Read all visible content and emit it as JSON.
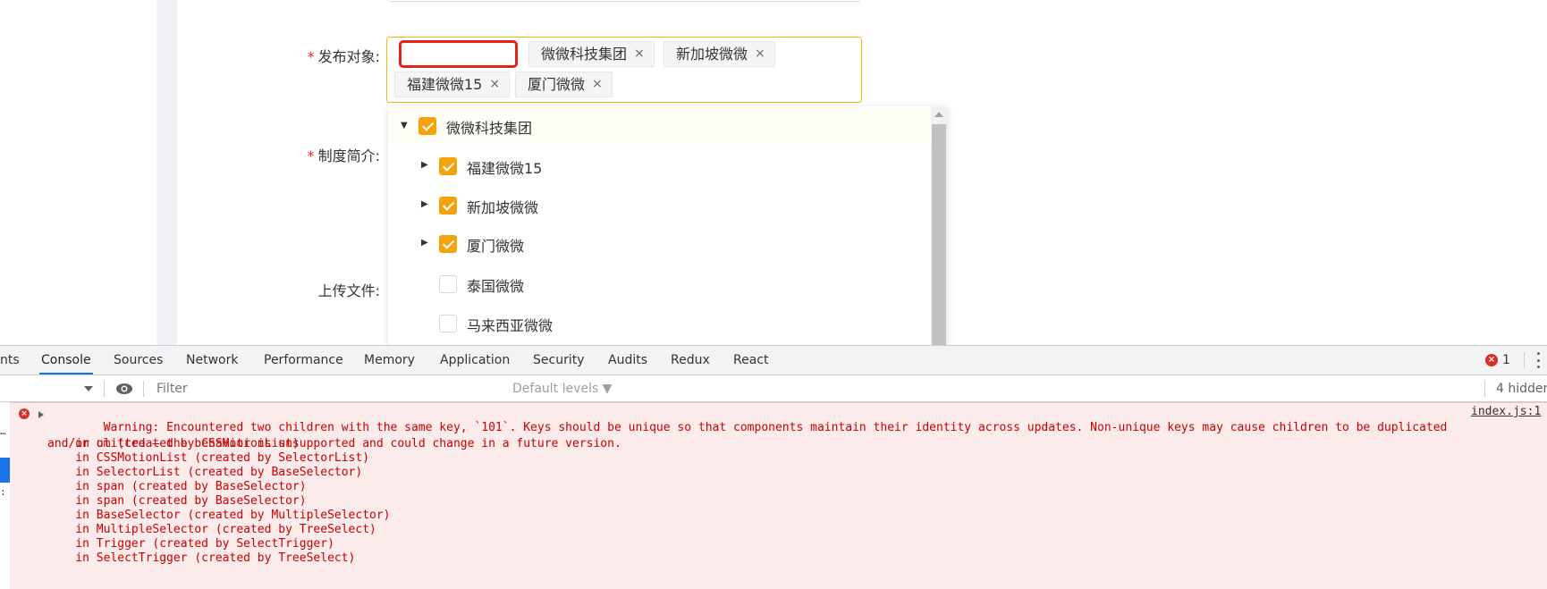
{
  "form": {
    "publish_target_label": "发布对象:",
    "policy_intro_label": "制度简介:",
    "upload_label": "上传文件:",
    "required_mark": "*",
    "search_value": "",
    "tags": [
      {
        "label": "微微科技集团"
      },
      {
        "label": "新加坡微微"
      },
      {
        "label": "福建微微15"
      },
      {
        "label": "厦门微微"
      }
    ],
    "tag_close_glyph": "×"
  },
  "tree": {
    "nodes": [
      {
        "label": "微微科技集团",
        "checked": true,
        "expanded": true,
        "level": 0
      },
      {
        "label": "福建微微15",
        "checked": true,
        "expanded": false,
        "level": 1
      },
      {
        "label": "新加坡微微",
        "checked": true,
        "expanded": false,
        "level": 1
      },
      {
        "label": "厦门微微",
        "checked": true,
        "expanded": false,
        "level": 1
      },
      {
        "label": "泰国微微",
        "checked": false,
        "expanded": false,
        "level": 1
      },
      {
        "label": "马来西亚微微",
        "checked": false,
        "expanded": false,
        "level": 1
      }
    ]
  },
  "devtools": {
    "partial_tab": "nts",
    "tabs": [
      "Console",
      "Sources",
      "Network",
      "Performance",
      "Memory",
      "Application",
      "Security",
      "Audits",
      "Redux",
      "React"
    ],
    "active_tab": "Console",
    "error_count": "1",
    "filter_placeholder": "Filter",
    "levels_label": "Default levels ▼",
    "hidden_label": "4 hidden",
    "left_dots": "…",
    "message": {
      "text": "Warning: Encountered two children with the same key, `101`. Keys should be unique so that components maintain their identity across updates. Non-unique keys may cause children to be duplicated and/or omitted — the behavior is unsupported and could change in a future version.",
      "source": "index.js:1",
      "stack": [
        "    in ul (created by CSSMotionList)",
        "    in CSSMotionList (created by SelectorList)",
        "    in SelectorList (created by BaseSelector)",
        "    in span (created by BaseSelector)",
        "    in span (created by BaseSelector)",
        "    in BaseSelector (created by MultipleSelector)",
        "    in MultipleSelector (created by TreeSelect)",
        "    in Trigger (created by SelectTrigger)",
        "    in SelectTrigger (created by TreeSelect)"
      ]
    }
  },
  "colors": {
    "accent": "#f5a30a",
    "required": "#f5222d",
    "error_text": "#c80000",
    "error_bg": "#fcebeb",
    "devtools_active": "#1a73e8"
  }
}
